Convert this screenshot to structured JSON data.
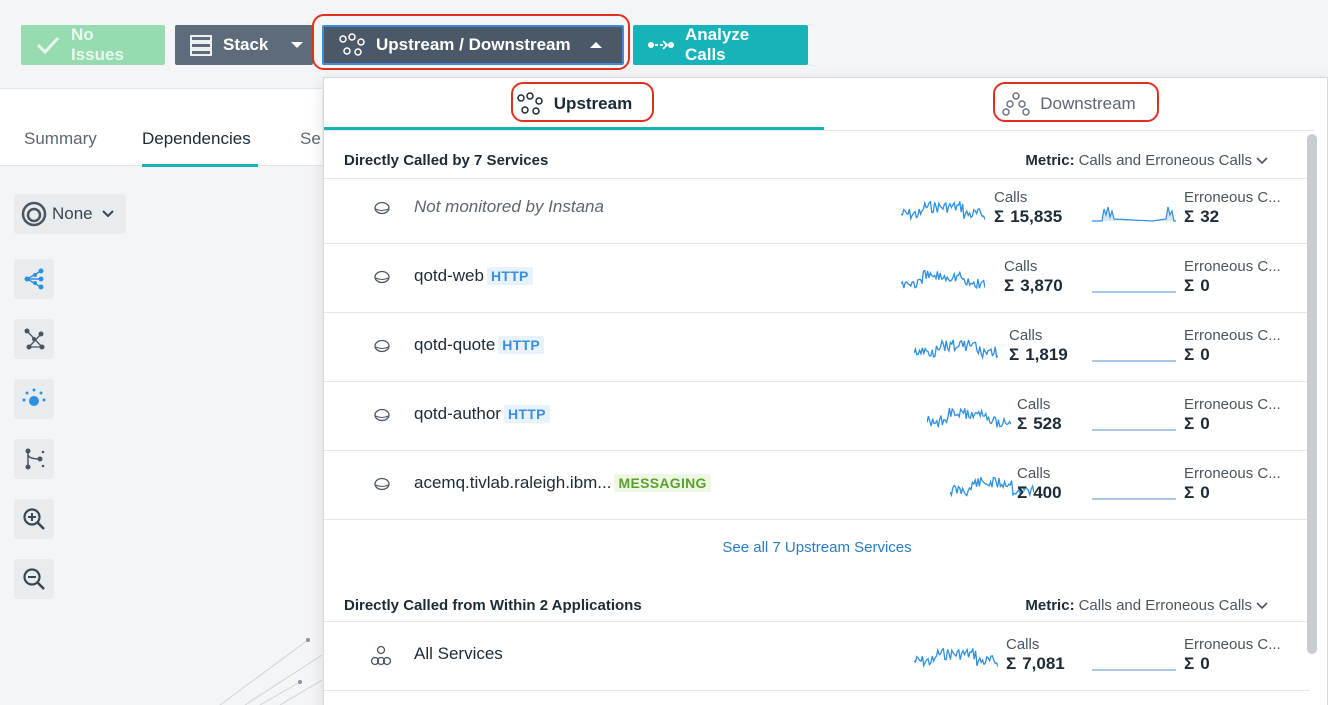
{
  "toolbar": {
    "no_issues": "No Issues",
    "stack": "Stack",
    "upstream_downstream": "Upstream / Downstream",
    "analyze_calls": "Analyze Calls"
  },
  "left_tabs": [
    "Summary",
    "Dependencies",
    "Se"
  ],
  "filter": {
    "value": "None"
  },
  "panel": {
    "tab_upstream": "Upstream",
    "tab_downstream": "Downstream",
    "section1": {
      "title": "Directly Called by 7 Services",
      "metric_label": "Metric:",
      "metric_value": "Calls and Erroneous Calls",
      "rows": [
        {
          "name": "Not monitored by Instana",
          "badge": "",
          "calls_label": "Calls",
          "calls": "15,835",
          "err_label": "Erroneous C...",
          "err": "32"
        },
        {
          "name": "qotd-web",
          "badge": "HTTP",
          "calls_label": "Calls",
          "calls": "3,870",
          "err_label": "Erroneous C...",
          "err": "0"
        },
        {
          "name": "qotd-quote",
          "badge": "HTTP",
          "calls_label": "Calls",
          "calls": "1,819",
          "err_label": "Erroneous C...",
          "err": "0"
        },
        {
          "name": "qotd-author",
          "badge": "HTTP",
          "calls_label": "Calls",
          "calls": "528",
          "err_label": "Erroneous C...",
          "err": "0"
        },
        {
          "name": "acemq.tivlab.raleigh.ibm...",
          "badge": "MESSAGING",
          "calls_label": "Calls",
          "calls": "400",
          "err_label": "Erroneous C...",
          "err": "0"
        }
      ],
      "see_all": "See all 7 Upstream Services"
    },
    "section2": {
      "title": "Directly Called from Within 2 Applications",
      "metric_label": "Metric:",
      "metric_value": "Calls and Erroneous Calls",
      "rows": [
        {
          "name": "All Services",
          "badge": "",
          "calls_label": "Calls",
          "calls": "7,081",
          "err_label": "Erroneous C...",
          "err": "0"
        }
      ]
    }
  },
  "sigma": "Σ",
  "colors": {
    "accent": "#16b3b8",
    "spark": "#2f8fe0",
    "highlight": "#e0301e"
  }
}
